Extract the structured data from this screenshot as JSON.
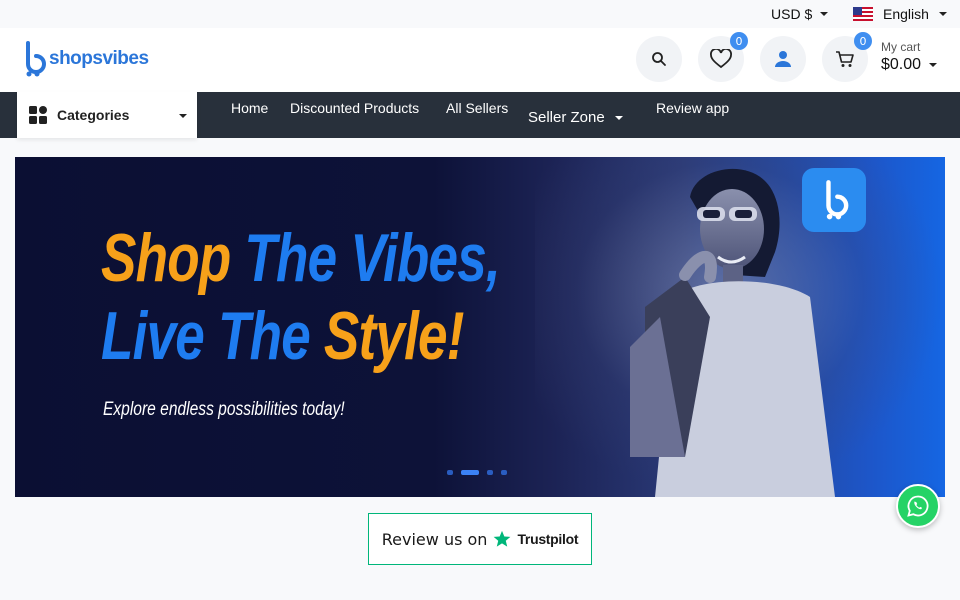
{
  "topbar": {
    "currency_label": "USD $",
    "language_label": "English"
  },
  "header": {
    "logo_text": "shopsvibes",
    "wishlist_count": "0",
    "cart_count": "0",
    "cart_label": "My cart",
    "cart_total": "$0.00"
  },
  "nav": {
    "categories_label": "Categories",
    "items": [
      {
        "label": "Home"
      },
      {
        "label": "Discounted Products"
      },
      {
        "label": "All Sellers"
      },
      {
        "label": "Seller Zone"
      },
      {
        "label": "Review app"
      }
    ]
  },
  "banner": {
    "headline_1a": "Shop",
    "headline_1b": "The Vibes,",
    "headline_2a": "Live The",
    "headline_2b": "Style!",
    "subline": "Explore endless possibilities today!",
    "slides": 4,
    "active_slide": 2
  },
  "trustpilot": {
    "prefix": "Review us on",
    "brand": "Trustpilot"
  },
  "colors": {
    "brand_blue": "#2b76d9",
    "nav_dark": "#28303b",
    "accent_orange": "#f7a11a",
    "trust_green": "#00b67a",
    "whatsapp_green": "#25d366"
  },
  "icons": [
    "search-icon",
    "heart-icon",
    "user-icon",
    "cart-icon",
    "grid-icon",
    "whatsapp-icon",
    "trustpilot-star-icon",
    "flag-us-icon"
  ]
}
